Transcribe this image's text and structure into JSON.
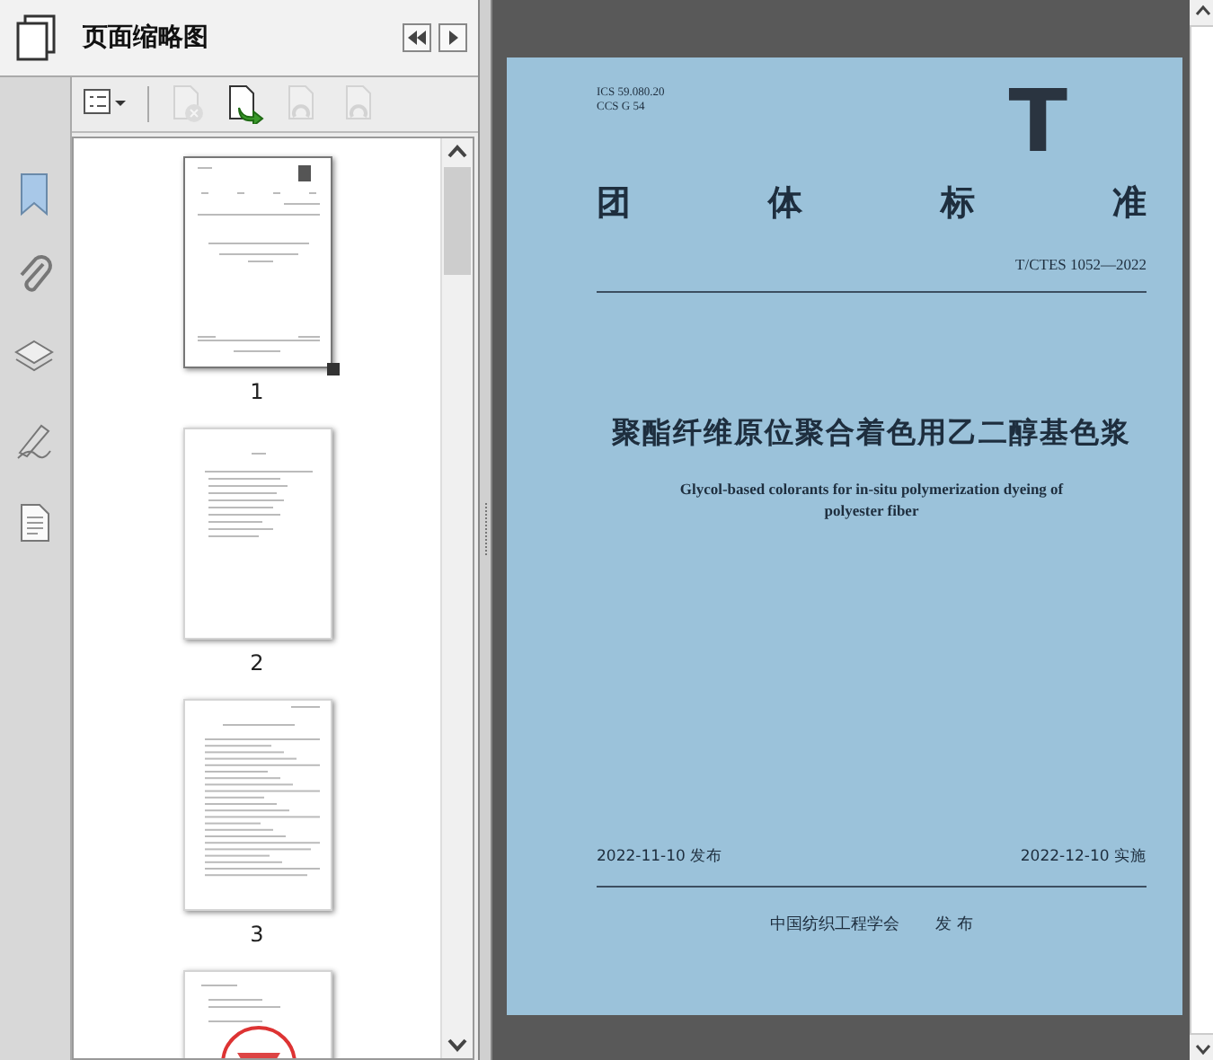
{
  "panel": {
    "title": "页面缩略图"
  },
  "sidebar": [
    {
      "kind": "bookmark",
      "selected": false
    },
    {
      "kind": "attachment",
      "selected": false
    },
    {
      "kind": "layers",
      "selected": false
    },
    {
      "kind": "signature",
      "selected": false
    },
    {
      "kind": "document",
      "selected": false
    }
  ],
  "toolbar": [
    {
      "kind": "options",
      "disabled": false
    },
    {
      "kind": "delete",
      "disabled": true
    },
    {
      "kind": "insert",
      "disabled": false
    },
    {
      "kind": "rotate-left",
      "disabled": true
    },
    {
      "kind": "rotate-right",
      "disabled": true
    }
  ],
  "thumbnails": [
    {
      "kind": "cover",
      "label": "1",
      "selected": true
    },
    {
      "kind": "contents",
      "label": "2",
      "selected": false
    },
    {
      "kind": "text",
      "label": "3",
      "selected": false
    },
    {
      "kind": "stamped",
      "selected": false
    }
  ],
  "document": {
    "ics": "ICS 59.080.20",
    "ccs": "CCS G 54",
    "logo": "T",
    "heading": [
      "团",
      "体",
      "标",
      "准"
    ],
    "code": "T/CTES 1052—2022",
    "title_zh": "聚酯纤维原位聚合着色用乙二醇基色浆",
    "title_en": "Glycol-based colorants for in-situ polymerization dyeing of\npolyester fiber",
    "issue_date": "2022-11-10 发布",
    "effective_date": "2022-12-10 实施",
    "publisher": "中国纺织工程学会",
    "publish_label": "发 布"
  }
}
